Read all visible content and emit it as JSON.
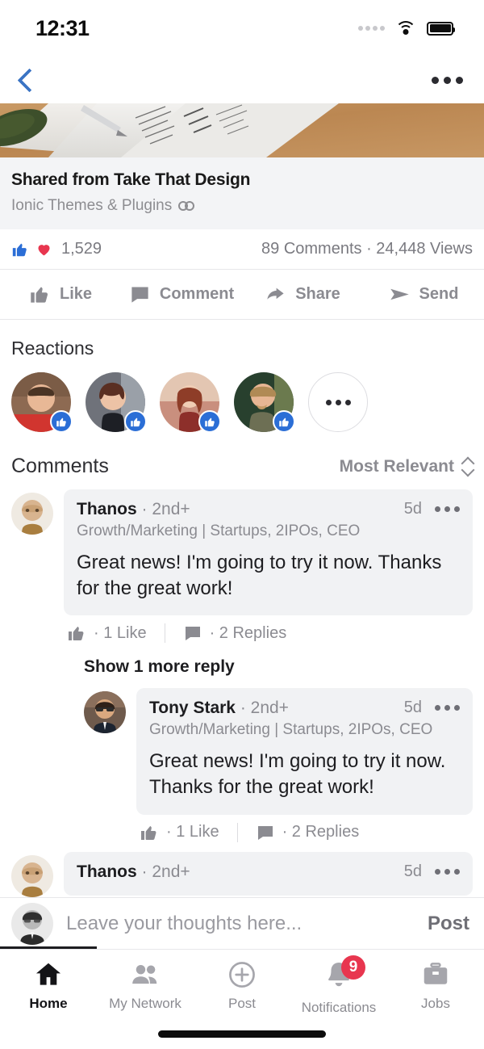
{
  "status_bar": {
    "time": "12:31",
    "icons": [
      "signal-dots-icon",
      "wifi-icon",
      "battery-icon"
    ]
  },
  "nav_bar": {
    "back_icon": "chevron-left-icon",
    "more_icon": "more-horizontal-icon"
  },
  "post": {
    "image_alt": "documents-and-pen-on-desk-photo",
    "link_card": {
      "title": "Shared from Take That Design",
      "subtitle": "Ionic Themes & Plugins",
      "link_icon": "chain-link-icon"
    },
    "social": {
      "reaction_icons": [
        "thumbs-up-icon",
        "heart-icon"
      ],
      "reaction_count": "1,529",
      "meta": "89 Comments · 24,448 Views"
    },
    "actions": [
      {
        "label": "Like",
        "icon": "thumbs-up-icon"
      },
      {
        "label": "Comment",
        "icon": "comment-bubble-icon"
      },
      {
        "label": "Share",
        "icon": "share-arrow-icon"
      },
      {
        "label": "Send",
        "icon": "send-paper-plane-icon"
      }
    ]
  },
  "reactions": {
    "title": "Reactions",
    "avatars": [
      {
        "name": "reaction-avatar-1",
        "badge": "like-badge-icon"
      },
      {
        "name": "reaction-avatar-2",
        "badge": "like-badge-icon"
      },
      {
        "name": "reaction-avatar-3",
        "badge": "like-badge-icon"
      },
      {
        "name": "reaction-avatar-4",
        "badge": "like-badge-icon"
      }
    ],
    "more_icon": "more-horizontal-icon"
  },
  "comments_section": {
    "title": "Comments",
    "sort": {
      "label": "Most Relevant",
      "icon": "sort-updown-icon"
    },
    "show_more_replies": "Show 1 more reply",
    "items": [
      {
        "author": "Thanos",
        "degree": "· 2nd+",
        "time": "5d",
        "headline": "Growth/Marketing | Startups, 2IPOs, CEO",
        "text": "Great news! I'm going to try it now. Thanks for the great work!",
        "likes": "· 1 Like",
        "replies": "· 2 Replies"
      },
      {
        "author": "Tony Stark",
        "degree": "· 2nd+",
        "time": "5d",
        "headline": "Growth/Marketing | Startups, 2IPOs, CEO",
        "text": "Great news! I'm going to try it now. Thanks for the great work!",
        "likes": "· 1 Like",
        "replies": "· 2 Replies"
      },
      {
        "author": "Thanos",
        "degree": "· 2nd+",
        "time": "5d"
      }
    ]
  },
  "composer": {
    "placeholder": "Leave your thoughts here...",
    "value": "",
    "post_label": "Post",
    "avatar": "current-user-avatar"
  },
  "tab_bar": {
    "items": [
      {
        "label": "Home",
        "icon": "home-icon",
        "active": true
      },
      {
        "label": "My Network",
        "icon": "people-icon",
        "active": false
      },
      {
        "label": "Post",
        "icon": "plus-circle-icon",
        "active": false
      },
      {
        "label": "Notifications",
        "icon": "bell-icon",
        "active": false,
        "badge": "9"
      },
      {
        "label": "Jobs",
        "icon": "briefcase-icon",
        "active": false
      }
    ]
  },
  "colors": {
    "accent_blue": "#2b6ed6",
    "back_chevron_blue": "#3b74c4",
    "heart_red": "#e8364f",
    "badge_red": "#e8364f",
    "bubble_gray": "#f1f2f4",
    "card_gray": "#f3f4f6",
    "muted_text": "#8b8b91"
  }
}
